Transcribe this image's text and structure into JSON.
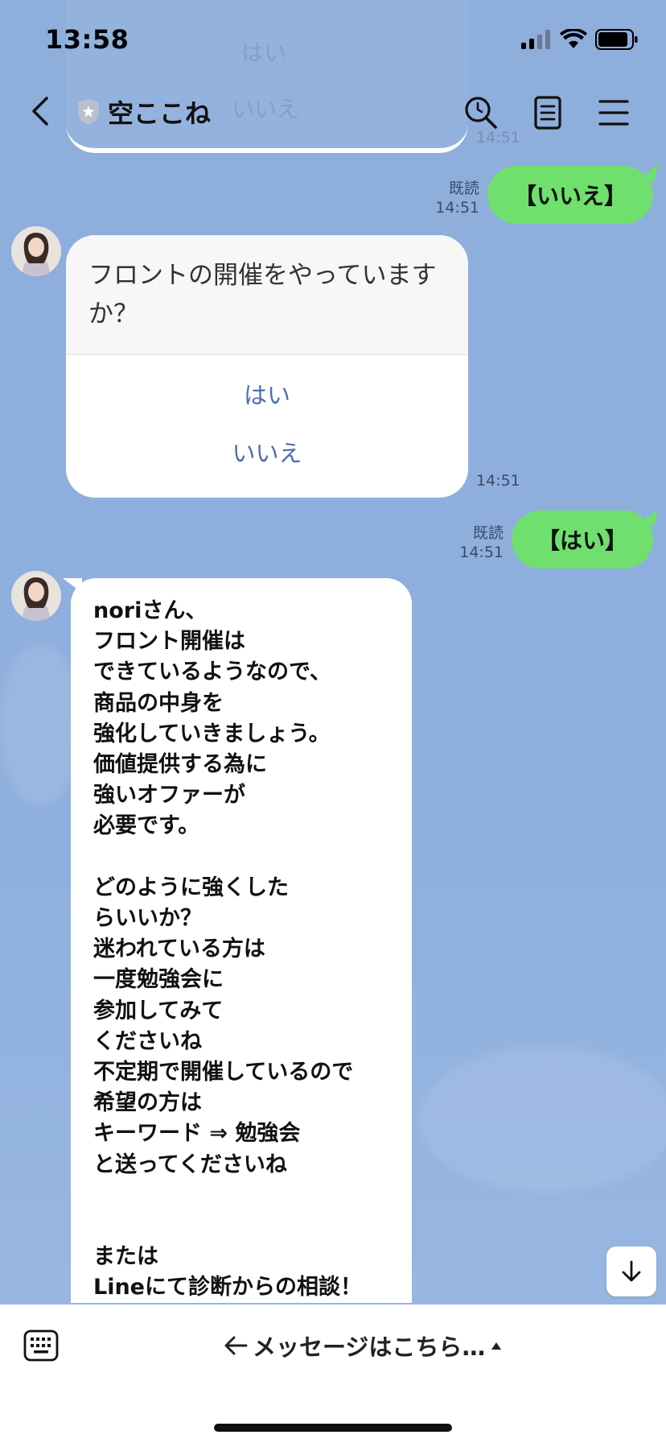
{
  "status_bar": {
    "time": "13:58"
  },
  "header": {
    "title": "空ここね"
  },
  "ghost_card": {
    "option_yes": "はい",
    "option_no": "いいえ",
    "time": "14:51"
  },
  "messages": {
    "out1": {
      "read": "既読",
      "time": "14:51",
      "text": "【いいえ】"
    },
    "card": {
      "question": "フロントの開催をやっていますか？",
      "option_yes": "はい",
      "option_no": "いいえ",
      "time": "14:51"
    },
    "out2": {
      "read": "既読",
      "time": "14:51",
      "text": "【はい】"
    },
    "long": {
      "lines": [
        "noriさん、",
        "フロント開催は",
        "できているようなので、",
        "商品の中身を",
        "強化していきましょう。",
        "価値提供する為に",
        "強いオファーが",
        "必要です。",
        "",
        "どのように強くした",
        "らいいか？",
        "迷われている方は",
        "一度勉強会に",
        "参加してみて",
        "くださいね",
        "不定期で開催しているので",
        "希望の方は",
        "キーワード ⇒ 勉強会",
        "と送ってくださいね",
        "",
        "",
        "または",
        "Lineにて診断からの相談！"
      ]
    }
  },
  "bottom_bar": {
    "menu_label": "メッセージはこちら…"
  },
  "colors": {
    "background": "#8eaedc",
    "bubble_out": "#6fe06d",
    "option_text": "#4c6faa"
  },
  "icons": [
    "signal-icon",
    "wifi-icon",
    "battery-icon",
    "back-icon",
    "shield-star-icon",
    "search-icon",
    "note-icon",
    "menu-icon",
    "arrow-down-icon",
    "keyboard-icon",
    "arrow-left-icon",
    "caret-up-icon"
  ]
}
